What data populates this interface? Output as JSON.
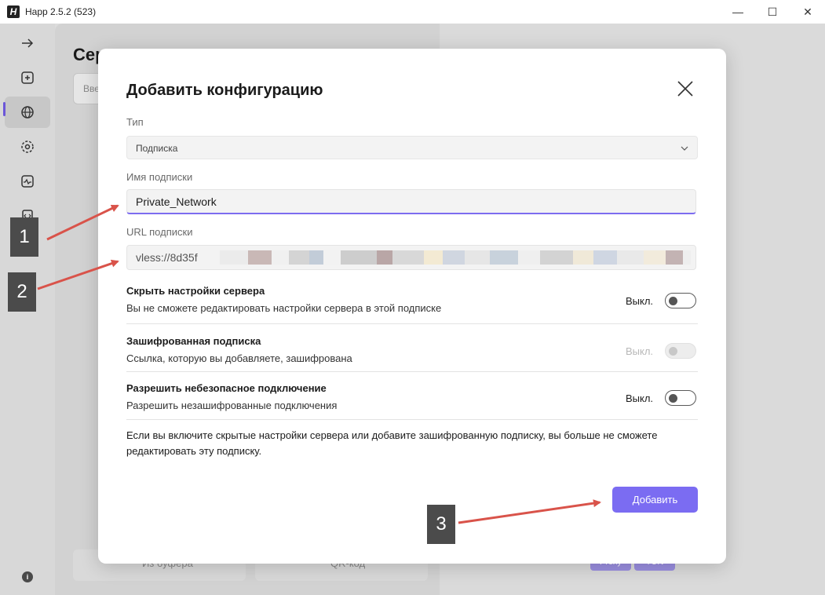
{
  "window": {
    "logo_text": "H",
    "title": "Happ 2.5.2 (523)",
    "minimize_icon": "—",
    "maximize_icon": "☐",
    "close_icon": "✕"
  },
  "sidebar": {
    "items": [
      {
        "icon": "arrow-right-icon"
      },
      {
        "icon": "plus-square-icon"
      },
      {
        "icon": "globe-icon",
        "active": true
      },
      {
        "icon": "gear-icon"
      },
      {
        "icon": "activity-icon"
      },
      {
        "icon": "code-file-icon"
      }
    ],
    "info_label": "i"
  },
  "background": {
    "page_title": "Сер",
    "search_placeholder": "Вве",
    "clipboard_button": "Из буфера",
    "qr_button": "QR-код",
    "pill_a": "Proxy",
    "pill_b": "TUN"
  },
  "dialog": {
    "title": "Добавить конфигурацию",
    "type_label": "Тип",
    "type_value": "Подписка",
    "name_label": "Имя подписки",
    "name_value": "Private_Network",
    "url_label": "URL подписки",
    "url_value": "vless://8d35f",
    "rows": [
      {
        "title": "Скрыть настройки сервера",
        "description": "Вы не сможете редактировать настройки сервера в этой подписке",
        "state": "Выкл.",
        "enabled": true
      },
      {
        "title": "Зашифрованная подписка",
        "description": "Ссылка, которую вы добавляете, зашифрована",
        "state": "Выкл.",
        "enabled": false
      },
      {
        "title": "Разрешить небезопасное подключение",
        "description": "Разрешить незашифрованные подключения",
        "state": "Выкл.",
        "enabled": true
      }
    ],
    "notice": "Если вы включите скрытые настройки сервера или добавите зашифрованную подписку, вы больше не сможете редактировать эту подписку.",
    "add_button": "Добавить"
  },
  "annotations": {
    "marker_1": "1",
    "marker_2": "2",
    "marker_3": "3",
    "arrow_color": "#d9534a"
  },
  "colors": {
    "accent": "#7b6cf2",
    "focus_underline": "#7d6cf0",
    "sidebar_indicator": "#6b56d8"
  }
}
